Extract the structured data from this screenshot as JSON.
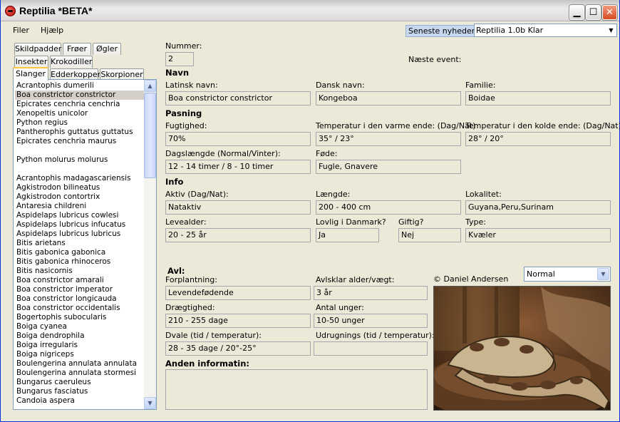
{
  "window": {
    "title": "Reptilia *BETA*"
  },
  "menu": [
    "Filer",
    "Hjælp"
  ],
  "news": {
    "label": "Seneste nyheder :",
    "value": "Reptilia 1.0b Klar"
  },
  "tabs_row1": [
    "Skildpadder",
    "Frøer",
    "Øgler"
  ],
  "tabs_row2": [
    "Insekter",
    "Krokodiller"
  ],
  "tabs_row3": [
    "Slanger",
    "Edderkopper",
    "Skorpioner"
  ],
  "species": [
    "Acrantophis dumerili",
    "Boa constrictor constrictor",
    "Epicrates cenchria cenchria",
    "Xenopeltis unicolor",
    "Python regius",
    "Pantherophis guttatus guttatus",
    "Epicrates cenchria maurus",
    "",
    "Python molurus molurus",
    "",
    "Acrantophis madagascariensis",
    "Agkistrodon bilineatus",
    "Agkistrodon contortrix",
    "Antaresia childreni",
    "Aspidelaps lubricus cowlesi",
    "Aspidelaps lubricus infucatus",
    "Aspidelaps lubricus lubricus",
    "Bitis arietans",
    "Bitis gabonica gabonica",
    "Bitis gabonica rhinoceros",
    "Bitis nasicornis",
    "Boa constrictor amarali",
    "Boa constrictor imperator",
    "Boa constrictor longicauda",
    "Boa constrictor occidentalis",
    "Bogertophis subocularis",
    "Boiga cyanea",
    "Boiga dendrophila",
    "Boiga irregularis",
    "Boiga nigriceps",
    "Boulengerina annulata annulata",
    "Boulengerina annulata stormesi",
    "Bungarus caeruleus",
    "Bungarus fasciatus",
    "Candoia aspera"
  ],
  "labels": {
    "nummer": "Nummer:",
    "naeste_event": "Næste event:",
    "navn": "Navn",
    "latinsk": "Latinsk navn:",
    "dansk": "Dansk navn:",
    "familie": "Familie:",
    "pasning": "Pasning",
    "fugtighed": "Fugtighed:",
    "temp_varme": "Temperatur i den varme ende: (Dag/Nat)",
    "temp_kolde": "Temperatur i den kolde ende: (Dag/Nat)",
    "dagslaengde": "Dagslængde (Normal/Vinter):",
    "foede": "Føde:",
    "info": "Info",
    "aktiv": "Aktiv (Dag/Nat):",
    "laengde": "Længde:",
    "lokalitet": "Lokalitet:",
    "levealder": "Levealder:",
    "lovlig": "Lovlig i Danmark?",
    "giftig": "Giftig?",
    "type": "Type:",
    "avl": "Avl:",
    "forplantning": "Forplantning:",
    "avlsklar": "Avlsklar alder/vægt:",
    "draegtighed": "Drægtighed:",
    "antal_unger": "Antal unger:",
    "dvale": "Dvale (tid / temperatur):",
    "udrugning": "Udrugnings (tid / temperatur):",
    "anden": "Anden informatin:",
    "copyright": "© Daniel Andersen"
  },
  "values": {
    "nummer": "2",
    "latinsk": "Boa constrictor constrictor",
    "dansk": "Kongeboa",
    "familie": "Boidae",
    "fugtighed": "70%",
    "temp_varme": "35° / 23°",
    "temp_kolde": "28° / 20°",
    "dagslaengde": "12 - 14 timer / 8 - 10 timer",
    "foede": "Fugle, Gnavere",
    "aktiv": "Nataktiv",
    "laengde": "200 - 400 cm",
    "lokalitet": "Guyana,Peru,Surinam",
    "levealder": "20 - 25 år",
    "lovlig": "Ja",
    "giftig": "Nej",
    "type": "Kvæler",
    "forplantning": "Levendefødende",
    "avlsklar": "3 år",
    "draegtighed": "210 - 255 dage",
    "antal_unger": "10-50 unger",
    "dvale": "28 - 35 dage / 20°-25°",
    "udrugning": ""
  },
  "image_size": {
    "selected": "Normal"
  },
  "colors": {
    "title_close": "#D74A22",
    "news_label_bg": "#C6D7EE",
    "selection": "#D4D0C8",
    "tab_highlight": "#FFC83C"
  }
}
